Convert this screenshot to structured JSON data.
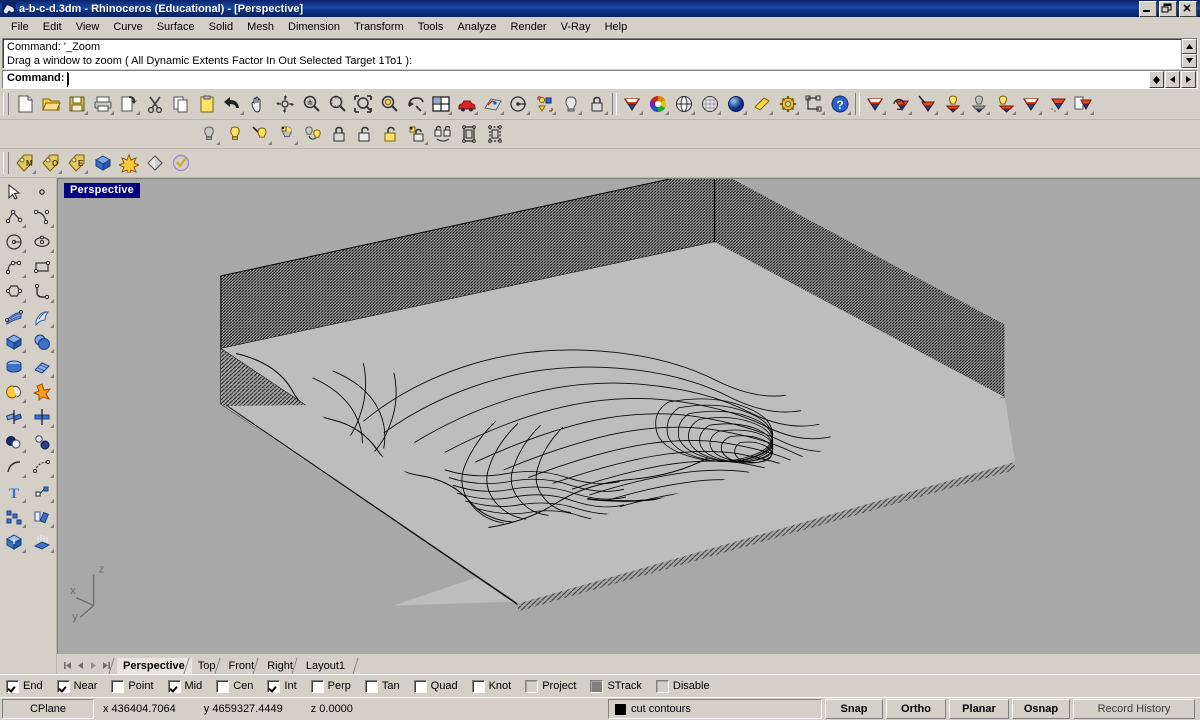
{
  "window": {
    "title": "a-b-c-d.3dm - Rhinoceros (Educational) - [Perspective]",
    "icon": "rhino-logo-icon",
    "buttons": {
      "minimize": "_",
      "restore": "❐",
      "close": "✕"
    }
  },
  "menubar": {
    "items": [
      {
        "label": "File"
      },
      {
        "label": "Edit"
      },
      {
        "label": "View"
      },
      {
        "label": "Curve"
      },
      {
        "label": "Surface"
      },
      {
        "label": "Solid"
      },
      {
        "label": "Mesh"
      },
      {
        "label": "Dimension"
      },
      {
        "label": "Transform"
      },
      {
        "label": "Tools"
      },
      {
        "label": "Analyze"
      },
      {
        "label": "Render"
      },
      {
        "label": "V-Ray"
      },
      {
        "label": "Help"
      }
    ]
  },
  "command": {
    "history": [
      "Command: '_Zoom",
      "Drag a window to zoom ( All  Dynamic  Extents  Factor  In  Out  Selected  Target  1To1 ):"
    ],
    "prompt": "Command:",
    "input_value": "",
    "scroll_up": "▲",
    "scroll_down": "▼",
    "nav_prev": "◀",
    "nav_next": "▶",
    "nav_updown": "▲▼"
  },
  "toolbars": {
    "standard": [
      {
        "name": "new-file-icon",
        "tip": "New"
      },
      {
        "name": "open-file-icon",
        "tip": "Open"
      },
      {
        "name": "save-file-icon",
        "tip": "Save"
      },
      {
        "name": "print-icon",
        "tip": "Print"
      },
      {
        "name": "copy-to-clipboard-icon",
        "tip": "Copy viewport to clipboard"
      },
      {
        "name": "cut-icon",
        "tip": "Cut"
      },
      {
        "name": "copy-icon",
        "tip": "Copy"
      },
      {
        "name": "paste-icon",
        "tip": "Paste"
      },
      {
        "name": "undo-icon",
        "tip": "Undo"
      },
      {
        "name": "pan-hand-icon",
        "tip": "Pan"
      },
      {
        "name": "rotate-view-icon",
        "tip": "Rotate view"
      },
      {
        "name": "zoom-in-out-icon",
        "tip": "Zoom in/out"
      },
      {
        "name": "zoom-window-icon",
        "tip": "Zoom window"
      },
      {
        "name": "zoom-extents-icon",
        "tip": "Zoom extents"
      },
      {
        "name": "zoom-selected-icon",
        "tip": "Zoom selected"
      },
      {
        "name": "zoom-previous-icon",
        "tip": "Zoom previous"
      },
      {
        "name": "viewport-layout-icon",
        "tip": "4 viewports"
      },
      {
        "name": "render-car-icon",
        "tip": "Render"
      },
      {
        "name": "render-preview-icon",
        "tip": "Render preview"
      },
      {
        "name": "named-view-icon",
        "tip": "Named views"
      },
      {
        "name": "object-properties-icon",
        "tip": "Properties"
      },
      {
        "name": "light-bulb-icon",
        "tip": "Lights"
      },
      {
        "name": "lock-icon",
        "tip": "Lock"
      },
      {
        "name": "layer-shield-icon",
        "tip": "Layers"
      },
      {
        "name": "color-wheel-icon",
        "tip": "Display color"
      },
      {
        "name": "shade-wireframe-icon",
        "tip": "Wireframe"
      },
      {
        "name": "shade-ghosted-icon",
        "tip": "Ghosted"
      },
      {
        "name": "shade-rendered-icon",
        "tip": "Rendered"
      },
      {
        "name": "shade-flat-icon",
        "tip": "Flat shade"
      },
      {
        "name": "options-gear-icon",
        "tip": "Options"
      },
      {
        "name": "distance-measure-icon",
        "tip": "Measure"
      },
      {
        "name": "help-icon",
        "tip": "Help"
      }
    ],
    "layers": [
      {
        "name": "layer-shield-icon",
        "tip": "Layer"
      },
      {
        "name": "layer-previous-icon",
        "tip": "Previous layer"
      },
      {
        "name": "layer-pick-icon",
        "tip": "Pick layer"
      },
      {
        "name": "layer-on-icon",
        "tip": "Layer on"
      },
      {
        "name": "layer-off-icon",
        "tip": "Layer off"
      },
      {
        "name": "layer-light-icon",
        "tip": "Layer light"
      },
      {
        "name": "layer-current-icon",
        "tip": "Current layer"
      },
      {
        "name": "layer-change-icon",
        "tip": "Change layer"
      },
      {
        "name": "layer-copy-icon",
        "tip": "Copy to layer"
      }
    ],
    "visibility": [
      {
        "name": "bulb-grey-icon",
        "tip": "Hide"
      },
      {
        "name": "bulb-yellow-icon",
        "tip": "Show"
      },
      {
        "name": "bulb-show-selected-icon",
        "tip": "Show selected"
      },
      {
        "name": "bulb-swap-icon",
        "tip": "Swap hidden"
      },
      {
        "name": "bulb-pair-icon",
        "tip": "Show objects"
      },
      {
        "name": "lock-closed-icon",
        "tip": "Lock"
      },
      {
        "name": "lock-open-icon",
        "tip": "Unlock"
      },
      {
        "name": "lock-yellow-icon",
        "tip": "Unlock selected"
      },
      {
        "name": "lock-swap-icon",
        "tip": "Swap locked"
      },
      {
        "name": "lock-toggle-icon",
        "tip": "Toggle lock"
      },
      {
        "name": "group-select-icon",
        "tip": "Group"
      },
      {
        "name": "ungroup-select-icon",
        "tip": "Ungroup"
      }
    ],
    "tags": [
      {
        "name": "tag-m-icon",
        "label": "M",
        "tip": "Move tag"
      },
      {
        "name": "tag-o-icon",
        "label": "O",
        "tip": "Object tag"
      },
      {
        "name": "tag-e-icon",
        "label": "E",
        "tip": "Edit tag"
      },
      {
        "name": "block-cube-icon",
        "tip": "Block"
      },
      {
        "name": "explode-star-icon",
        "tip": "Explode"
      },
      {
        "name": "diamond-surface-icon",
        "tip": "Surface"
      },
      {
        "name": "circle-check-icon",
        "tip": "Check"
      }
    ],
    "sidebar_left": [
      {
        "name": "select-arrow-icon",
        "tip": "Select"
      },
      {
        "name": "polyline-icon",
        "tip": "Polyline"
      },
      {
        "name": "circle-icon",
        "tip": "Circle"
      },
      {
        "name": "arc-icon",
        "tip": "Arc"
      },
      {
        "name": "polygon-icon",
        "tip": "Polygon"
      },
      {
        "name": "surface-grid-icon",
        "tip": "Surface from points"
      },
      {
        "name": "box-solid-icon",
        "tip": "Box"
      },
      {
        "name": "cylinder-solid-icon",
        "tip": "Cylinder"
      },
      {
        "name": "boolean-union-icon",
        "tip": "Boolean union"
      },
      {
        "name": "split-icon",
        "tip": "Split"
      },
      {
        "name": "sphere-pair-icon",
        "tip": "Boolean"
      },
      {
        "name": "fillet-curve-icon",
        "tip": "Fillet"
      },
      {
        "name": "text-tool-icon",
        "tip": "Text"
      },
      {
        "name": "array-icon",
        "tip": "Array"
      },
      {
        "name": "extrude-solid-icon",
        "tip": "Extrude"
      },
      {
        "name": "grid-snap-icon",
        "tip": "Grid"
      }
    ],
    "sidebar_right": [
      {
        "name": "point-icon",
        "tip": "Point"
      },
      {
        "name": "curve-control-icon",
        "tip": "Control point curve"
      },
      {
        "name": "ellipse-icon",
        "tip": "Ellipse"
      },
      {
        "name": "rectangle-icon",
        "tip": "Rectangle"
      },
      {
        "name": "curve-arc-icon",
        "tip": "Curve"
      },
      {
        "name": "surface-sweep-icon",
        "tip": "Sweep"
      },
      {
        "name": "sphere-solid-icon",
        "tip": "Sphere"
      },
      {
        "name": "plane-surface-icon",
        "tip": "Plane"
      },
      {
        "name": "explode-burst-icon",
        "tip": "Explode"
      },
      {
        "name": "trim-icon",
        "tip": "Trim"
      },
      {
        "name": "circles-pair-icon",
        "tip": "Offset"
      },
      {
        "name": "blend-curve-icon",
        "tip": "Blend"
      },
      {
        "name": "point-edit-icon",
        "tip": "Point edit"
      },
      {
        "name": "rotate-copy-icon",
        "tip": "Rotate"
      },
      {
        "name": "extrude-surface-icon",
        "tip": "Extrude surface"
      },
      {
        "name": "analyze-grid-icon",
        "tip": "Analyze"
      }
    ]
  },
  "viewport": {
    "label": "Perspective",
    "background_color": "#a8a8a8",
    "axis": {
      "x": "x",
      "y": "y",
      "z": "z"
    },
    "model_description": "Contour-line terrain block model with hatched side walls"
  },
  "viewport_tabs": {
    "nav": {
      "first": "|◀",
      "prev": "◀",
      "next": "▶",
      "last": "▶|"
    },
    "items": [
      {
        "label": "Perspective",
        "active": true
      },
      {
        "label": "Top",
        "active": false
      },
      {
        "label": "Front",
        "active": false
      },
      {
        "label": "Right",
        "active": false
      },
      {
        "label": "Layout1",
        "active": false
      }
    ]
  },
  "osnap": {
    "items": [
      {
        "label": "End",
        "checked": true,
        "style": "normal"
      },
      {
        "label": "Near",
        "checked": true,
        "style": "normal"
      },
      {
        "label": "Point",
        "checked": false,
        "style": "normal"
      },
      {
        "label": "Mid",
        "checked": true,
        "style": "normal"
      },
      {
        "label": "Cen",
        "checked": false,
        "style": "normal"
      },
      {
        "label": "Int",
        "checked": true,
        "style": "normal"
      },
      {
        "label": "Perp",
        "checked": false,
        "style": "normal"
      },
      {
        "label": "Tan",
        "checked": false,
        "style": "normal"
      },
      {
        "label": "Quad",
        "checked": false,
        "style": "normal"
      },
      {
        "label": "Knot",
        "checked": false,
        "style": "normal"
      },
      {
        "label": "Project",
        "checked": false,
        "style": "grey"
      },
      {
        "label": "STrack",
        "checked": false,
        "style": "grey-fill"
      },
      {
        "label": "Disable",
        "checked": false,
        "style": "grey"
      }
    ]
  },
  "statusbar": {
    "cplane_label": "CPlane",
    "coord_x": "x 436404.7064",
    "coord_y": "y 4659327.4449",
    "coord_z": "z 0.0000",
    "layer_name": "cut contours",
    "layer_color": "#000000",
    "toggles": [
      {
        "label": "Snap",
        "active": true
      },
      {
        "label": "Ortho",
        "active": true
      },
      {
        "label": "Planar",
        "active": true
      },
      {
        "label": "Osnap",
        "active": true
      },
      {
        "label": "Record History",
        "active": false
      }
    ]
  }
}
